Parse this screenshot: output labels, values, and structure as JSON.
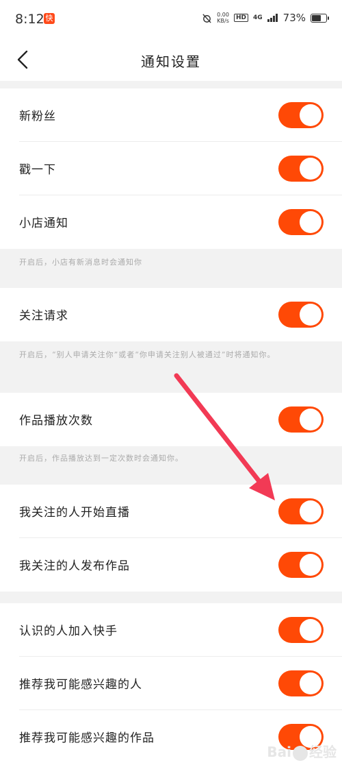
{
  "status": {
    "time": "8:12",
    "app_icon": "快",
    "speed": "0.00",
    "speed_unit": "KB/s",
    "hd": "HD",
    "network": "4G",
    "battery_text": "73%",
    "battery_level": 0.73
  },
  "header": {
    "title": "通知设置"
  },
  "rows": [
    {
      "label": "新粉丝",
      "on": true
    },
    {
      "label": "戳一下",
      "on": true
    },
    {
      "label": "小店通知",
      "on": true
    },
    {
      "label": "关注请求",
      "on": true
    },
    {
      "label": "作品播放次数",
      "on": true
    },
    {
      "label": "我关注的人开始直播",
      "on": true
    },
    {
      "label": "我关注的人发布作品",
      "on": true
    },
    {
      "label": "认识的人加入快手",
      "on": true
    },
    {
      "label": "推荐我可能感兴趣的人",
      "on": true
    },
    {
      "label": "推荐我可能感兴趣的作品",
      "on": true
    }
  ],
  "hints": {
    "shop": "开启后，小店有新消息时会通知你",
    "follow_request": "开启后，“别人申请关注你”或者“你申请关注别人被通过”时将通知你。",
    "play_count": "开启后，作品播放达到一定次数时会通知你。"
  },
  "watermark": {
    "left": "Bai",
    "right": "经验"
  },
  "colors": {
    "toggle_on": "#ff4906",
    "arrow": "#f23a55"
  }
}
